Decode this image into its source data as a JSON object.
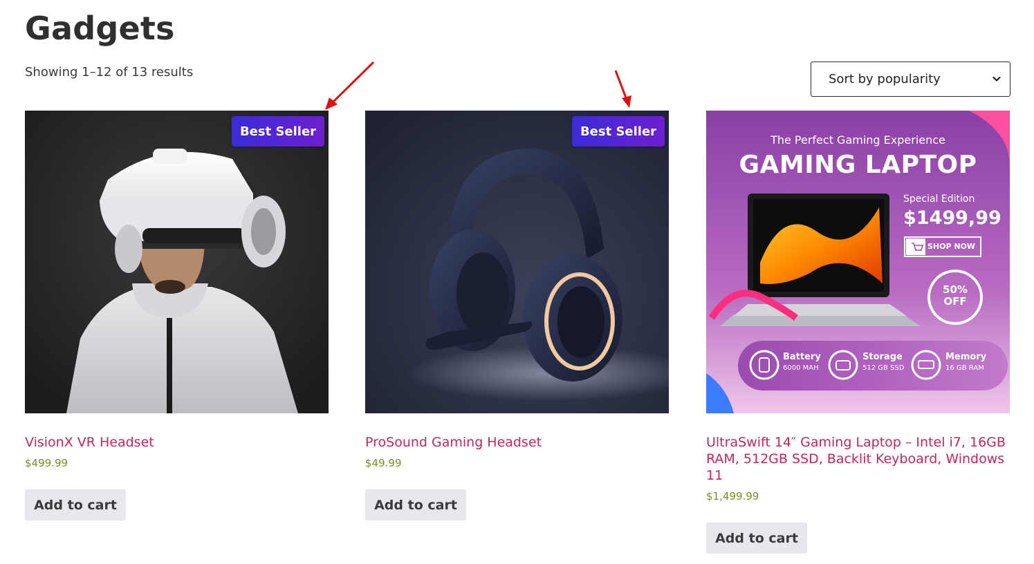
{
  "page": {
    "title": "Gadgets",
    "result_count": "Showing 1–12 of 13 results"
  },
  "sort": {
    "selected": "Sort by popularity"
  },
  "products": [
    {
      "title": "VisionX VR Headset",
      "price": "$499.99",
      "badge": "Best Seller",
      "button": "Add to cart"
    },
    {
      "title": "ProSound Gaming Headset",
      "price": "$49.99",
      "badge": "Best Seller",
      "button": "Add to cart"
    },
    {
      "title": "UltraSwift 14″ Gaming Laptop – Intel i7, 16GB RAM, 512GB SSD, Backlit Keyboard, Windows 11",
      "price": "$1,499.99",
      "button": "Add to cart",
      "banner": {
        "tagline": "The Perfect Gaming Experience",
        "headline": "GAMING LAPTOP",
        "edition": "Special Edition",
        "price": "$1499,99",
        "shop": "SHOP NOW",
        "discount_value": "50%",
        "discount_label": "OFF",
        "specs": [
          {
            "name": "Battery",
            "value": "6000 MAH"
          },
          {
            "name": "Storage",
            "value": "512 GB SSD"
          },
          {
            "name": "Memory",
            "value": "16 GB RAM"
          }
        ]
      }
    }
  ],
  "colors": {
    "title_link": "#c2265b",
    "price": "#7f8b26",
    "badge_start": "#3b2bd8",
    "badge_end": "#6d1fd0",
    "annotation_arrow": "#e01010"
  }
}
